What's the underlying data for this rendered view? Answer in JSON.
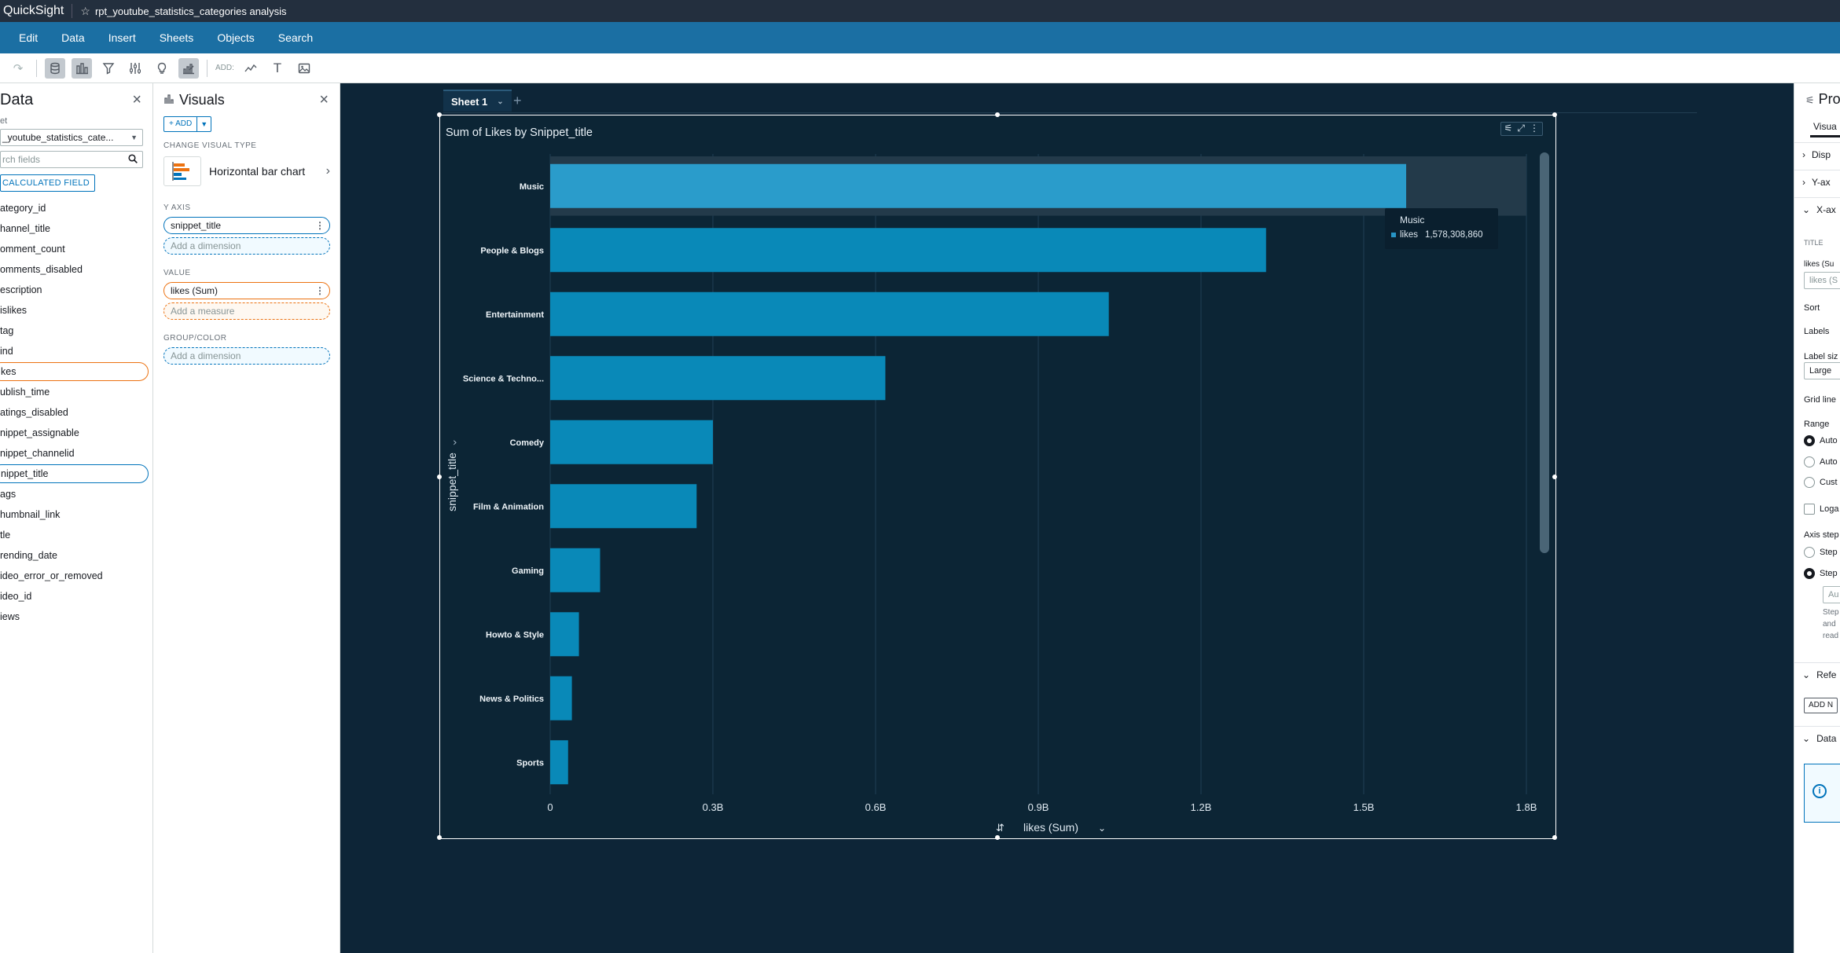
{
  "app": {
    "brand": "QuickSight",
    "analysis_title": "rpt_youtube_statistics_categories analysis"
  },
  "menu": [
    "Edit",
    "Data",
    "Insert",
    "Sheets",
    "Objects",
    "Search"
  ],
  "toolbar": {
    "add_label": "ADD:"
  },
  "data_pane": {
    "title": "Data",
    "dataset_label": "et",
    "dataset_value": "_youtube_statistics_cate...",
    "search_placeholder": "rch fields",
    "calc_field_label": "CALCULATED FIELD",
    "fields": [
      "ategory_id",
      "hannel_title",
      "omment_count",
      "omments_disabled",
      "escription",
      "islikes",
      "tag",
      "ind",
      "kes",
      "ublish_time",
      "atings_disabled",
      "nippet_assignable",
      "nippet_channelid",
      "nippet_title",
      "ags",
      "humbnail_link",
      "tle",
      "rending_date",
      "ideo_error_or_removed",
      "ideo_id",
      "iews"
    ],
    "selected_measure": "kes",
    "selected_dimension": "nippet_title"
  },
  "visuals_pane": {
    "title": "Visuals",
    "add_label": "+ ADD",
    "change_type_label": "CHANGE VISUAL TYPE",
    "visual_type": "Horizontal bar chart",
    "y_axis_label": "Y AXIS",
    "y_axis_field": "snippet_title",
    "add_dimension": "Add a dimension",
    "value_label": "VALUE",
    "value_field": "likes (Sum)",
    "add_measure": "Add a measure",
    "group_label": "GROUP/COLOR",
    "add_dimension_group": "Add a dimension"
  },
  "sheet": {
    "tab_label": "Sheet 1",
    "add": "+"
  },
  "tooltip": {
    "title": "Music",
    "field": "likes",
    "value": "1,578,308,860"
  },
  "chart_data": {
    "type": "bar",
    "orientation": "horizontal",
    "title": "Sum of Likes by Snippet_title",
    "xlabel": "likes (Sum)",
    "ylabel": "snippet_title",
    "categories": [
      "Music",
      "People & Blogs",
      "Entertainment",
      "Science & Techno...",
      "Comedy",
      "Film & Animation",
      "Gaming",
      "Howto & Style",
      "News & Politics",
      "Sports"
    ],
    "values": [
      1578308860,
      1320000000,
      1030000000,
      618000000,
      300000000,
      270000000,
      92000000,
      53000000,
      40000000,
      33000000
    ],
    "xlim": [
      0,
      1800000000
    ],
    "xticks": [
      0,
      300000000,
      600000000,
      900000000,
      1200000000,
      1500000000,
      1800000000
    ],
    "xtick_labels": [
      "0",
      "0.3B",
      "0.6B",
      "0.9B",
      "1.2B",
      "1.5B",
      "1.8B"
    ],
    "highlighted_category": "Music",
    "bar_color": "#0989b8",
    "highlight_color": "#2a9ccb"
  },
  "properties_pane": {
    "title": "Pro",
    "tab": "Visua",
    "sections": [
      "Disp",
      "Y-ax",
      "X-ax"
    ],
    "title_label": "TITLE",
    "title_value": "likes (Su",
    "title_input": "likes (S",
    "sort": "Sort",
    "labels": "Labels",
    "label_size": "Label siz",
    "label_size_value": "Large",
    "grid_lines": "Grid line",
    "range": "Range",
    "range_options": [
      "Auto",
      "Auto",
      "Cust"
    ],
    "log": "Loga",
    "axis_step": "Axis step",
    "step_options": [
      "Step",
      "Step"
    ],
    "step_input": "Au",
    "step_help": [
      "Step",
      "and",
      "read"
    ],
    "reference": "Refe",
    "add_button": "ADD N",
    "data": "Data"
  }
}
